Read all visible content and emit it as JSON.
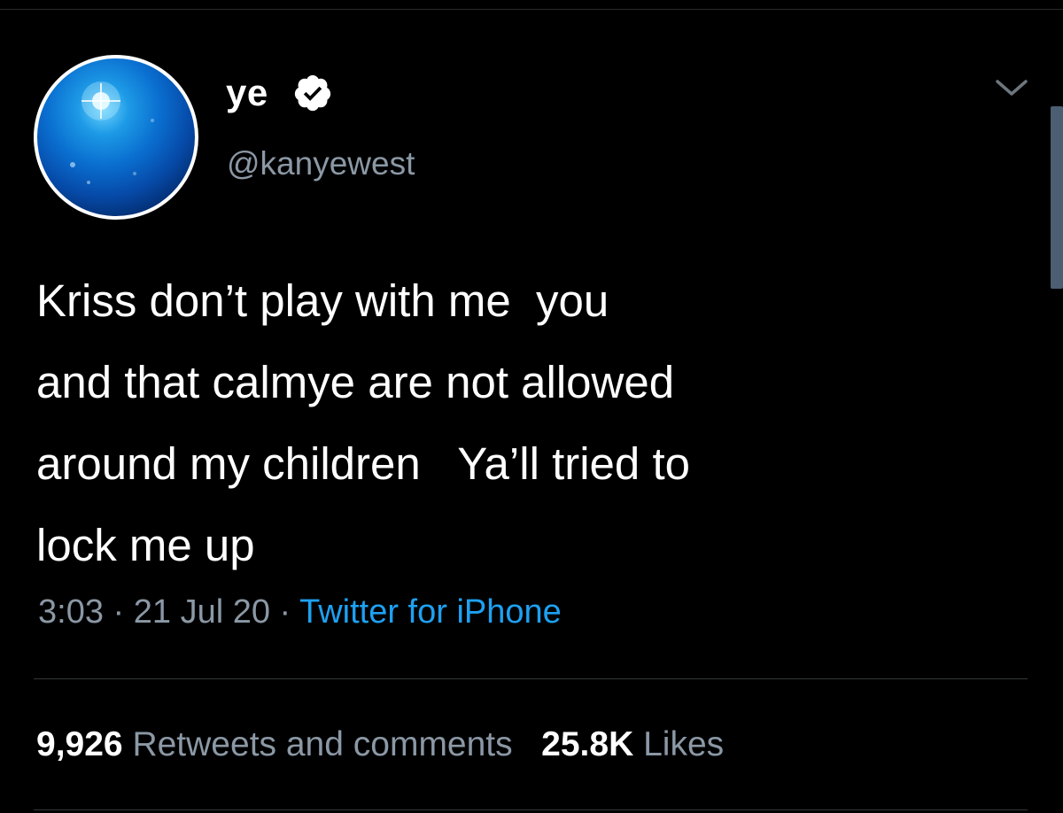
{
  "author": {
    "display_name": "ye",
    "handle": "@kanyewest",
    "verified": true
  },
  "icons": {
    "verified": "verified-badge-icon",
    "menu": "chevron-down-icon"
  },
  "tweet": {
    "lines": [
      "Kriss don’t play with me  you",
      "and that calmye are not allowed",
      "around my children   Ya’ll tried to",
      "lock me up"
    ]
  },
  "meta": {
    "time": "3:03",
    "separator": " · ",
    "date": "21 Jul 20",
    "source": "Twitter for iPhone"
  },
  "stats": {
    "retweets_count": "9,926",
    "retweets_label": "Retweets and comments",
    "likes_count": "25.8K",
    "likes_label": "Likes"
  },
  "colors": {
    "background": "#000000",
    "text": "#ffffff",
    "secondary": "#8b98a5",
    "accent": "#1da1f2"
  }
}
